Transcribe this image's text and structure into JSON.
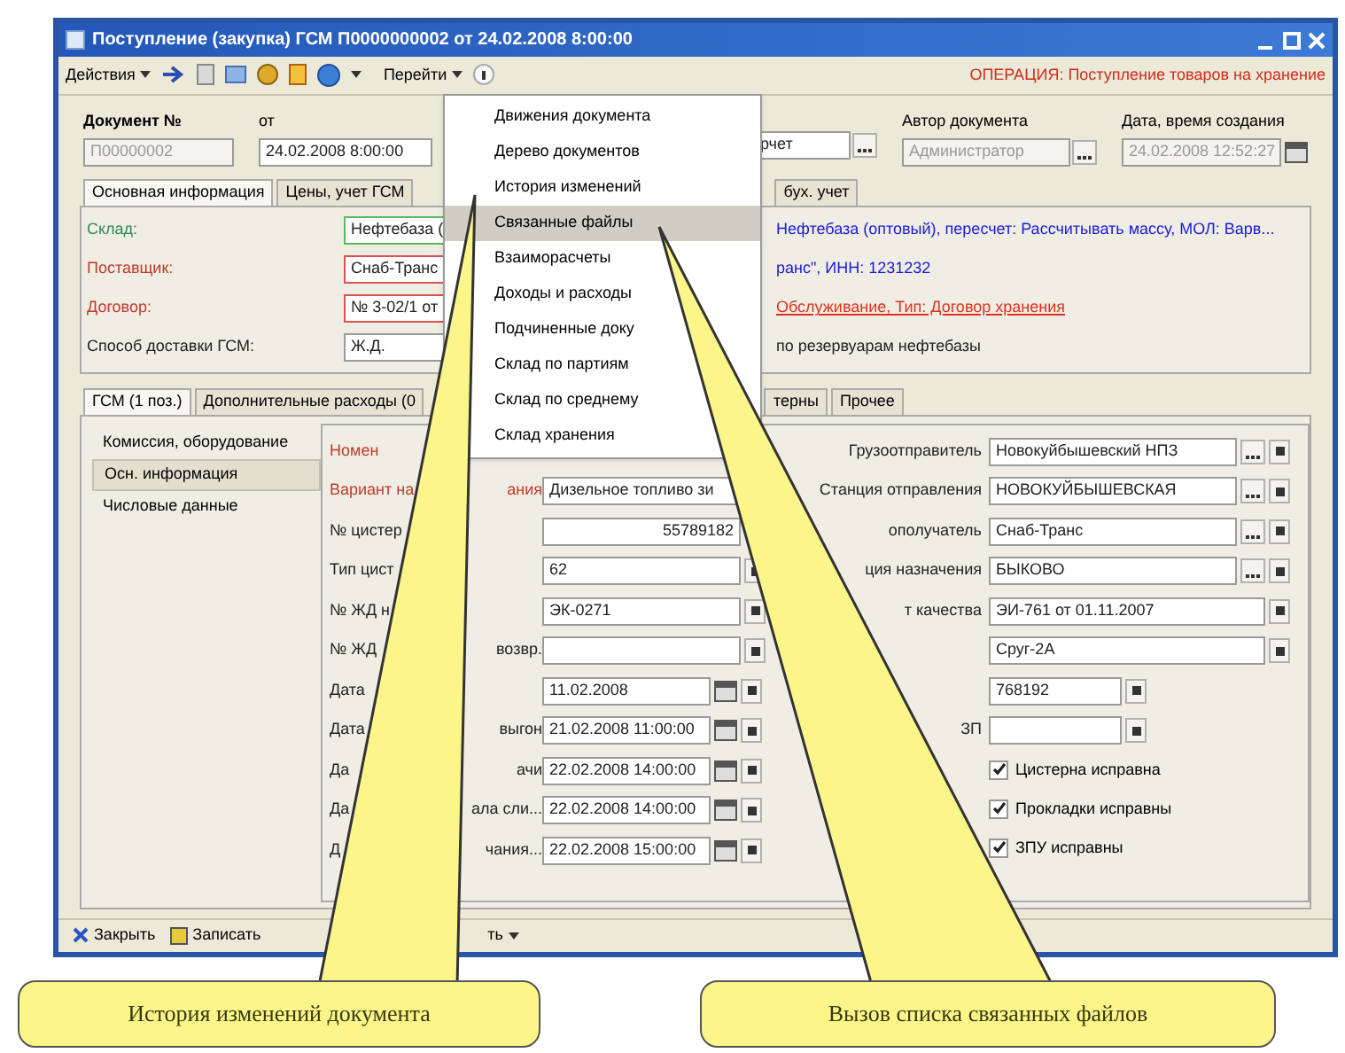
{
  "window": {
    "title": "Поступление (закупка) ГСМ П0000000002 от 24.02.2008 8:00:00"
  },
  "toolbar": {
    "actions": "Действия",
    "goto": "Перейти",
    "operation": "ОПЕРАЦИЯ: Поступление товаров на хранение"
  },
  "goto_menu": [
    {
      "label": "Движения документа",
      "selected": false
    },
    {
      "label": "Дерево документов",
      "selected": false
    },
    {
      "label": "История изменений",
      "selected": false
    },
    {
      "label": "Связанные файлы",
      "selected": true
    },
    {
      "label": "Взаиморасчеты",
      "selected": false
    },
    {
      "label": "Доходы и расходы",
      "selected": false
    },
    {
      "label": "Подчиненные доку",
      "selected": false
    },
    {
      "label": "Склад по партиям",
      "selected": false
    },
    {
      "label": "Склад по среднему",
      "selected": false
    },
    {
      "label": "Склад хранения",
      "selected": false
    }
  ],
  "header": {
    "number_label": "Документ №",
    "number": "П00000002",
    "date_label": "от",
    "date": "24.02.2008 8:00:00",
    "field_3": "рчет",
    "author_label": "Автор документа",
    "author": "Администратор",
    "created_label": "Дата, время создания",
    "created": "24.02.2008 12:52:27"
  },
  "tabs": [
    {
      "label": "Основная информация",
      "selected": true
    },
    {
      "label": "Цены, учет ГСМ",
      "selected": false
    },
    {
      "label": "бух. учет",
      "selected": false
    }
  ],
  "main_rows": [
    {
      "label": "Склад:",
      "kind": "ok",
      "value": "Нефтебаза (",
      "info": {
        "text": "Нефтебаза (оптовый), пересчет: Рассчитывать массу, МОЛ: Варв...",
        "kind": "link"
      }
    },
    {
      "label": "Поставщик:",
      "kind": "required",
      "value": "Снаб-Транс",
      "info": {
        "text": "ранс\", ИНН: 1231232",
        "kind": "link"
      }
    },
    {
      "label": "Договор:",
      "kind": "required",
      "value": "№ 3-02/1 от",
      "info": {
        "text": "Обслуживание, Тип: Договор хранения",
        "kind": "error"
      }
    },
    {
      "label": "Способ доставки ГСМ:",
      "kind": "plain",
      "value": "Ж.Д.",
      "info": {
        "text": "по резервуарам нефтебазы",
        "kind": "text"
      }
    }
  ],
  "lower_tabs": [
    {
      "label": "ГСМ (1 поз.)",
      "selected": true
    },
    {
      "label": "Дополнительные расходы (0",
      "selected": false
    },
    {
      "label": "терны",
      "selected": false
    },
    {
      "label": "Прочее",
      "selected": false
    }
  ],
  "sections": [
    {
      "label": "Комиссия, оборудование",
      "selected": false
    },
    {
      "label": "Осн. информация",
      "selected": true
    },
    {
      "label": "Числовые данные",
      "selected": false
    }
  ],
  "left_fields": [
    {
      "label": "Номен",
      "kind": "required"
    },
    {
      "label": "Вариант на",
      "tail": "ания",
      "kind": "required",
      "field": {
        "value": "Дизельное топливо зи",
        "kind": "text"
      }
    },
    {
      "label": "№ цистер",
      "kind": "plain",
      "field": {
        "value": "55789182",
        "kind": "number"
      }
    },
    {
      "label": "Тип цист",
      "kind": "plain",
      "field": {
        "value": "62",
        "kind": "clearable"
      }
    },
    {
      "label": "№ ЖД н",
      "kind": "plain",
      "field": {
        "value": "ЭК-0271",
        "kind": "clearable"
      }
    },
    {
      "label": "№ ЖД",
      "tail": "возвр.",
      "kind": "plain",
      "field": {
        "kind": "clearable"
      }
    },
    {
      "label": "Дата",
      "kind": "plain",
      "field": {
        "value": "11.02.2008",
        "kind": "date"
      }
    },
    {
      "label": "Дата",
      "tail": "выгон",
      "kind": "plain",
      "field": {
        "value": "21.02.2008 11:00:00",
        "kind": "date"
      }
    },
    {
      "label": "Да",
      "tail": "ачи",
      "kind": "plain",
      "field": {
        "value": "22.02.2008 14:00:00",
        "kind": "date"
      }
    },
    {
      "label": "Да",
      "tail": "ала сли...",
      "kind": "plain",
      "field": {
        "value": "22.02.2008 14:00:00",
        "kind": "date"
      }
    },
    {
      "label": "Д",
      "tail": "чания...",
      "kind": "plain",
      "field": {
        "value": "22.02.2008 15:00:00",
        "kind": "date"
      }
    }
  ],
  "right_fields": [
    {
      "label": "Грузоотправитель",
      "value": "Новокуйбышевский НПЗ",
      "kind": "ref"
    },
    {
      "label": "Станция отправления",
      "value": "НОВОКУЙБЫШЕВСКАЯ",
      "kind": "ref"
    },
    {
      "label": "ополучатель",
      "value": "Снаб-Транс",
      "kind": "ref"
    },
    {
      "label": "ция назначения",
      "value": "БЫКОВО",
      "kind": "ref"
    },
    {
      "label": "т качества",
      "value": "ЭИ-761 от 01.11.2007",
      "kind": "clearable"
    },
    {
      "value": "Сруг-2А",
      "kind": "clearable"
    },
    {
      "value": "768192",
      "kind": "code"
    },
    {
      "label": "ЗП",
      "kind": "code"
    }
  ],
  "checkboxes": [
    {
      "label": "Цистерна исправна",
      "checked": true
    },
    {
      "label": "Прокладки исправны",
      "checked": true
    },
    {
      "label": "ЗПУ исправны",
      "checked": true
    }
  ],
  "footer": [
    {
      "kind": "close",
      "label": "Закрыть"
    },
    {
      "kind": "save",
      "label": "Записать"
    },
    {
      "kind": "print",
      "label": "ть"
    }
  ],
  "callouts": [
    {
      "text": "История изменений документа"
    },
    {
      "text": "Вызов списка связанных файлов"
    }
  ]
}
